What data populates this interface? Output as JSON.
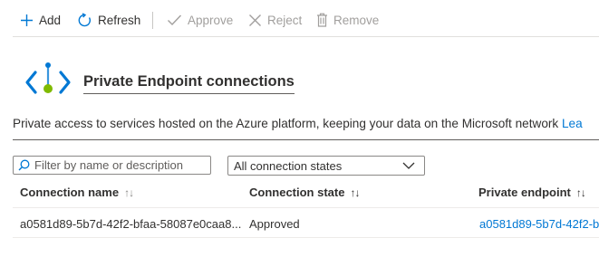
{
  "toolbar": {
    "add_label": "Add",
    "refresh_label": "Refresh",
    "approve_label": "Approve",
    "reject_label": "Reject",
    "remove_label": "Remove"
  },
  "section": {
    "title": "Private Endpoint connections",
    "icon": "private-endpoint-icon",
    "description": "Private access to services hosted on the Azure platform, keeping your data on the Microsoft network",
    "learn_more": "Lea"
  },
  "filter": {
    "placeholder": "Filter by name or description",
    "state_selected": "All connection states"
  },
  "table": {
    "columns": [
      "Connection name",
      "Connection state",
      "Private endpoint"
    ],
    "rows": [
      {
        "connection_name": "a0581d89-5b7d-42f2-bfaa-58087e0caa8...",
        "connection_state": "Approved",
        "private_endpoint": "a0581d89-5b7d-42f2-b"
      }
    ]
  },
  "colors": {
    "accent": "#0078d4",
    "disabled": "#a19f9d",
    "endpoint_green": "#7fba00"
  }
}
